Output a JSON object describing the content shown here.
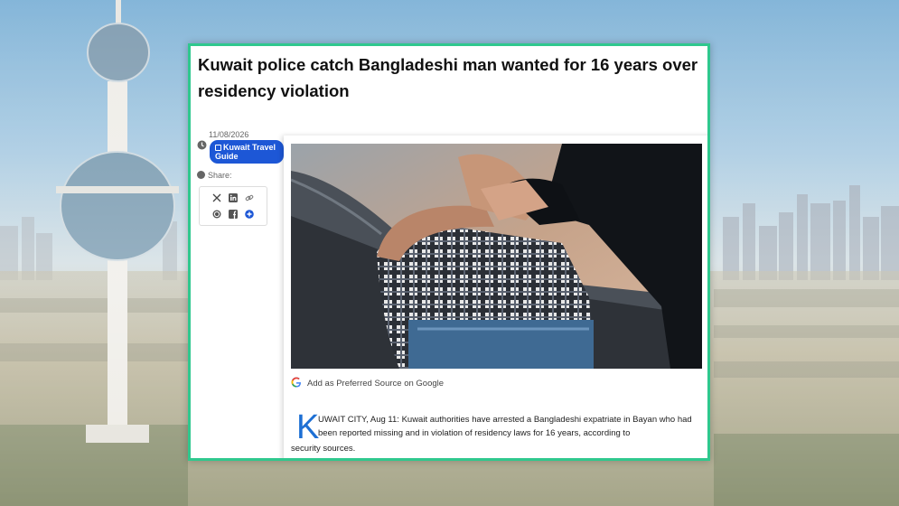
{
  "article": {
    "headline": "Kuwait police catch Bangladeshi man wanted for 16 years over residency violation",
    "date": "11/08/2026",
    "category": "Kuwait Travel Guide",
    "share_label": "Share:",
    "share_icons": [
      "x-icon",
      "linkedin-icon",
      "link-icon",
      "whatsapp-icon",
      "facebook-icon",
      "more-icon"
    ],
    "google_source": "Add as Preferred Source on Google",
    "drop_cap": "K",
    "lead_line1": "UWAIT CITY, Aug 11: Kuwait authorities have arrested a Bangladeshi expatriate in Bayan who had been reported missing and in violation of residency laws for 16 years, according to",
    "lead_line2": "security sources."
  },
  "colors": {
    "card_border": "#2fc88e",
    "badge": "#1d57d6",
    "drop_cap": "#1d6fd4"
  }
}
